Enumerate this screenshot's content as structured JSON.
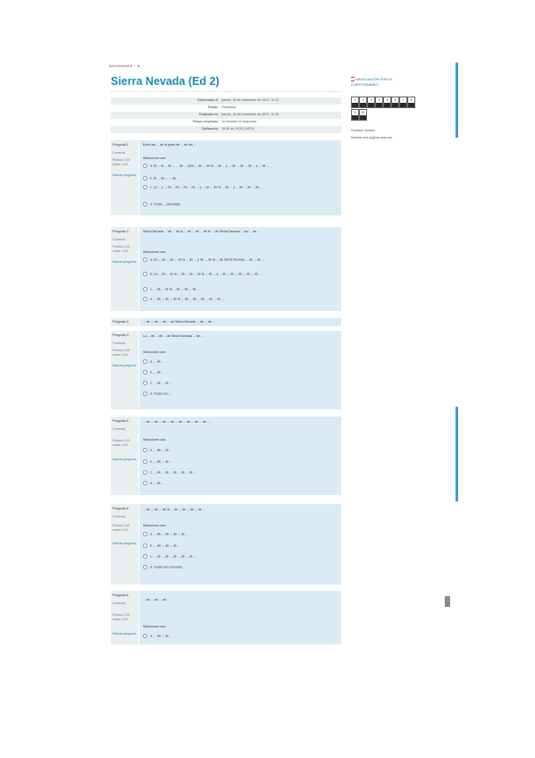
{
  "breadcrumb": "Área personal  ►  ...  ►  ...",
  "title": "Sierra Nevada (Ed 2)",
  "summary": [
    {
      "label": "Comenzado el",
      "value": "jueves, 18 de noviembre de 2021, 11:13"
    },
    {
      "label": "Estado",
      "value": "Finalizado"
    },
    {
      "label": "Finalizado en",
      "value": "jueves, 18 de noviembre de 2021, 11:23"
    },
    {
      "label": "Tiempo empleado",
      "value": "10 minutos 22 segundos"
    },
    {
      "label": "Calificación",
      "value": "10,00 de 10,00 (100%)"
    }
  ],
  "questions": [
    {
      "number": "Pregunta 1",
      "status": "Correcta",
      "points": "Puntúa 1,00 sobre 1,00",
      "flag": "Marcar pregunta",
      "text": "Entre las ... de la parte de ... de las ...",
      "select_label": "Seleccione una:",
      "options": [
        "a. El ... la ... de ... ... de ... para ... de ... de la ... de ... y ... de ... de ... de ... y ... de ... ...",
        "b. El ... de ... ... de ...",
        "c. La ... y ... de ... de ... de ... de ... y ... de ... de la ... de ... y ... de ... de ... de ...",
        "d. Todas ... correctas."
      ]
    },
    {
      "number": "Pregunta 2",
      "status": "Correcta",
      "points": "Puntúa 1,00 sobre 1,00",
      "flag": "Marcar pregunta",
      "text": "Sierra Nevada ... de ... de la ... de ... de ... de la ... de Sierra Nevada ... las ... de ...",
      "select_label": "Seleccione una:",
      "options": [
        "a. En ... de ... de ... de la ... de ... y de ... de la ... de Sierra Nevada ... de ... de ...",
        "b. La ... de ... de la ... de ... de ... de la ... de ... y ... de ... de ... de ... de ... de ...",
        "c. ... de ... de la ... de ... de ... de ...",
        "d. ... de ... de ... de la ... de ... de ... de ... de ... de ..."
      ]
    },
    {
      "number": "Pregunta 3",
      "text": "... de ... de ... de ... de Sierra Nevada ... de ... de ..."
    },
    {
      "number": "Pregunta 3",
      "status": "Correcta",
      "points": "Puntúa 1,00 sobre 1,00",
      "flag": "Marcar pregunta",
      "text": "La ... de ... de ... de Sierra Nevada ... de ...",
      "select_label": "Seleccione una:",
      "options": [
        "a. ... de ...",
        "b. ... de ...",
        "c. ... de ... de ...",
        "d. Todas son ..."
      ]
    },
    {
      "number": "Pregunta 4",
      "status": "Correcta",
      "points": "Puntúa 1,00 sobre 1,00",
      "flag": "Marcar pregunta",
      "text": "... de ... de ... de ... de ... de ... de ... de ... de ...",
      "select_label": "Seleccione una:",
      "options": [
        "a. ... de ... de ...",
        "b. ... de ... de ...",
        "c. ... de ... de ... de ... de ... de ...",
        "d. ... de ..."
      ]
    },
    {
      "number": "Pregunta 5",
      "status": "Correcta",
      "points": "Puntúa 1,00 sobre 1,00",
      "flag": "Marcar pregunta",
      "text": "... de ... de ... de la ... de ... de ... de ... de ...",
      "select_label": "Seleccione una:",
      "options": [
        "a. ... de ... de ... de ... de ...",
        "b. ... de ... de ... de ...",
        "c. ... de ... de ... de ... de ... de ...",
        "d. Todas son correctas."
      ]
    },
    {
      "number": "Pregunta 6",
      "status": "Correcta",
      "points": "Puntúa 1,00 sobre 1,00",
      "flag": "Marcar pregunta",
      "text": "... de ... de ... de ...",
      "select_label": "Seleccione una:",
      "options": [
        "a. ... de ... de ..."
      ]
    }
  ],
  "nav": {
    "title": "NAVEGACIÓN POR EL CUESTIONARIO",
    "boxes": [
      "1",
      "2",
      "3",
      "4",
      "5",
      "6",
      "7",
      "8",
      "9",
      "10"
    ],
    "finish_review": "Finalizar revisión",
    "show_one_page": "Mostrar una página cada vez"
  },
  "colors": {
    "accent": "#1a8ab3",
    "question_bg": "#dbebf6",
    "info_bg": "#e9eef0",
    "scrollbar": "#3b9ed0"
  }
}
